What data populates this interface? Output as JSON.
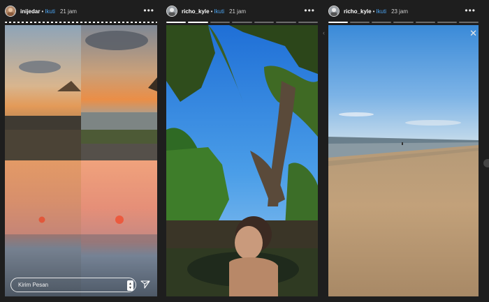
{
  "stories": [
    {
      "username": "inijedar",
      "follow_label": "Ikuti",
      "separator": "•",
      "time": "21 jam",
      "more_icon": "more-horizontal-icon",
      "progress_total": 1,
      "progress_done": 0
    },
    {
      "username": "richo_kyle",
      "follow_label": "Ikuti",
      "separator": "•",
      "time": "21 jam",
      "more_icon": "more-horizontal-icon",
      "progress_total": 7,
      "progress_done": 2
    },
    {
      "username": "richo_kyle",
      "follow_label": "Ikuti",
      "separator": "•",
      "time": "23 jam",
      "more_icon": "more-horizontal-icon",
      "progress_total": 7,
      "progress_done": 1
    }
  ],
  "reply": {
    "placeholder": "Kirim Pesan"
  },
  "colors": {
    "follow": "#4aa3f0",
    "background": "#1e1e1e"
  }
}
